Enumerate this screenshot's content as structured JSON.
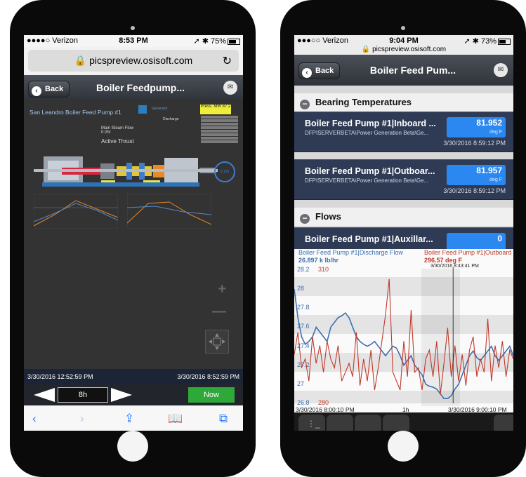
{
  "left_phone": {
    "status": {
      "carrier": "●●●●○ Verizon ",
      "time": "8:53 PM",
      "right": "➚ ✱ 75%"
    },
    "url": "🔒 picspreview.osisoft.com",
    "nav": {
      "back": "Back",
      "title": "Boiler Feedpump..."
    },
    "display": {
      "title": "San Leandro Boiler Feed Pump #1",
      "generator_label": "Generator",
      "generator_value": "Press. MW\n87.2",
      "steam_label": "Main Steam Flow",
      "steam_value": "0 t/hr",
      "thrust_label": "Active Thrust",
      "discharge_label": "Discharge",
      "gauge_text": "0.155"
    },
    "time_range": {
      "start": "3/30/2016 12:52:59 PM",
      "end": "3/30/2016 8:52:59 PM"
    },
    "controls": {
      "duration": "8h",
      "now": "Now"
    },
    "toolbar": [
      "‹",
      "›",
      "⇪",
      "📖",
      "⧉"
    ],
    "zoom_in": "+",
    "zoom_out": "—"
  },
  "right_phone": {
    "status": {
      "carrier": "●●●○○ Verizon ",
      "time": "9:04 PM",
      "right": "➚ ✱ 73%"
    },
    "url": "🔒 picspreview.osisoft.com",
    "nav": {
      "back": "Back",
      "title": "Boiler Feed Pum..."
    },
    "sections": [
      {
        "title": "Bearing Temperatures"
      },
      {
        "title": "Flows"
      }
    ],
    "items": [
      {
        "name": "Boiler Feed Pump #1|Inboard ...",
        "path": "DFPISERVERBETA\\Power Generation Beta\\Ge...",
        "value": "81.952",
        "unit": "deg F",
        "time": "3/30/2016 8:59:12 PM"
      },
      {
        "name": "Boiler Feed Pump #1|Outboar...",
        "path": "DFPISERVERBETA\\Power Generation Beta\\Ge...",
        "value": "81.957",
        "unit": "deg F",
        "time": "3/30/2016 8:59:12 PM"
      },
      {
        "name": "Boiler Feed Pump #1|Auxillar...",
        "path": "",
        "value": "0",
        "unit": "",
        "time": ""
      }
    ],
    "trend": {
      "series1_name": "Boiler Feed Pump #1|Discharge Flow",
      "series1_value": "26.897 k lb/hr",
      "series2_name": "Boiler Feed Pump #1|Outboard",
      "series2_value": "296.57 deg F",
      "cursor_time": "3/30/2016 8:43:41 PM",
      "start": "3/30/2016 8:00:10 PM",
      "duration": "1h",
      "end": "3/30/2016 9:00:10 PM"
    }
  },
  "chart_data": {
    "type": "line",
    "title": "",
    "xlabel": "",
    "ylabel": "",
    "ylim": [
      26.8,
      28.2
    ],
    "y_ticks": [
      "28.2",
      "28",
      "27.8",
      "27.6",
      "27.4",
      "27.2",
      "27",
      "26.8"
    ],
    "y2_ticks": [
      "310",
      "280"
    ],
    "y2lim": [
      280,
      310
    ],
    "x": [
      0,
      1,
      2,
      3,
      4,
      5,
      6,
      7,
      8,
      9,
      10,
      11,
      12,
      13,
      14,
      15,
      16,
      17,
      18,
      19,
      20,
      21,
      22,
      23,
      24,
      25,
      26,
      27,
      28,
      29,
      30,
      31,
      32,
      33,
      34,
      35,
      36,
      37,
      38,
      39,
      40,
      41,
      42,
      43,
      44,
      45,
      46,
      47,
      48,
      49,
      50,
      51,
      52,
      53,
      54,
      55,
      56,
      57,
      58,
      59,
      60
    ],
    "series": [
      {
        "name": "Boiler Feed Pump #1|Discharge Flow",
        "color": "#3e6fb1",
        "values": [
          28.0,
          27.7,
          27.5,
          27.42,
          27.45,
          27.5,
          27.6,
          27.55,
          27.5,
          27.45,
          27.6,
          27.65,
          27.7,
          27.72,
          27.75,
          27.7,
          27.6,
          27.5,
          27.45,
          27.42,
          27.4,
          27.42,
          27.45,
          27.4,
          27.35,
          27.3,
          27.35,
          27.4,
          27.38,
          27.3,
          27.2,
          27.25,
          27.3,
          27.2,
          27.15,
          27.1,
          27.0,
          26.98,
          26.97,
          26.95,
          26.9,
          26.85,
          26.85,
          26.88,
          26.95,
          27.0,
          27.1,
          27.2,
          27.3,
          27.35,
          27.28,
          27.25,
          27.3,
          27.35,
          27.4,
          27.3,
          27.25,
          27.3,
          27.35,
          27.4,
          27.3
        ]
      },
      {
        "name": "Boiler Feed Pump #1|Outboard",
        "color": "#c0392b",
        "values": [
          291,
          296,
          288,
          290,
          285,
          295,
          289,
          293,
          287,
          294,
          290,
          288,
          293,
          285,
          287,
          289,
          286,
          296,
          284,
          290,
          285,
          292,
          283,
          288,
          294,
          300,
          308,
          287,
          285,
          283,
          294,
          286,
          301,
          287,
          288,
          283,
          290,
          292,
          286,
          294,
          282,
          289,
          297,
          286,
          293,
          285,
          291,
          284,
          292,
          295,
          286,
          290,
          287,
          299,
          285,
          293,
          288,
          294,
          286,
          292,
          290
        ]
      }
    ]
  }
}
